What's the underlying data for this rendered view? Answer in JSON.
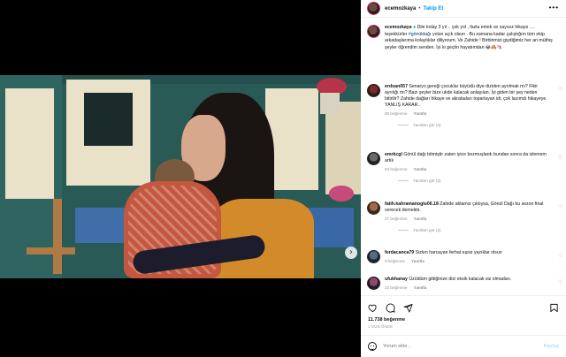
{
  "header": {
    "username": "ecemozkaya",
    "separator": "•",
    "follow_label": "Takip Et",
    "more_icon": "more-horizontal-icon"
  },
  "caption": {
    "username": "ecemozkaya",
    "text_before_tag": "Dile kolay 3 yıl .. çok yol , fazla emek ve sayısız hikaye …. teşekkürler",
    "tag": "#gönüldağı",
    "text_after_tag": "yolun açık olsun . Bu zamana kadar çalıştığım tüm ekip arkadaşlarıma kolaylıklar diliyorum. Ve Zahide ! Birbirimizi giydiğimiz her an müthiş şeyler öğrendim senden. İyi ki geçtin hayatımdan 😂🙈🦄"
  },
  "comments": [
    {
      "username": "erdoan057",
      "text": "Senaryo gereği çocuklar büyüdü diye diziden ayrılmak mı? Fikir ayrılığı mı? Bazı şeyler bize ukde kalacak anlaşılan. İyi giden bir şey neden bitirilir? Zahide dağları hikaye ve akrabaları toparlayan idi, çok lazımdı hikayeye. YANLIŞ KARAR..",
      "likes": "90 beğenme",
      "reply": "Yanıtla",
      "replies": "Yanıtları gör (4)"
    },
    {
      "username": "emrkcgl",
      "text": "Gönül dağı bitmiştir zaten iyice bozmuşlardı bundan sonra da izlemem artık",
      "likes": "63 beğenme",
      "reply": "Yanıtla",
      "replies": "Yanıtları gör (3)"
    },
    {
      "username": "fatih.kahramanoglu06.18",
      "text": "Zahide ablamız çıktıysa, Gönül Dağı bu sezon final verecek demektir.",
      "likes": "27 beğenme",
      "reply": "Yanıtla",
      "replies": "Yanıtları gör (2)"
    },
    {
      "username": "ferdacanca79",
      "text": "Sizlen harcayan ferhat eşsiz yazıklar olsun",
      "likes": "9 beğenme",
      "reply": "Yanıtla",
      "replies": ""
    },
    {
      "username": "ufukhanay",
      "text": "Üzüldüm gittiğinize dizi eksik kalacak siz olmadan.",
      "likes": "23 beğenme",
      "reply": "Yanıtla",
      "replies": ""
    }
  ],
  "actions": {
    "like_icon": "heart-icon",
    "comment_icon": "comment-icon",
    "share_icon": "share-icon",
    "save_icon": "bookmark-icon"
  },
  "post": {
    "likes": "11.738 beğenme",
    "date": "1 GÜN ÖNCE"
  },
  "add_comment": {
    "placeholder": "Yorum ekle...",
    "post_label": "Paylaş"
  },
  "media": {
    "next_glyph": "›",
    "slide_count": 3,
    "active_slide": 1
  }
}
